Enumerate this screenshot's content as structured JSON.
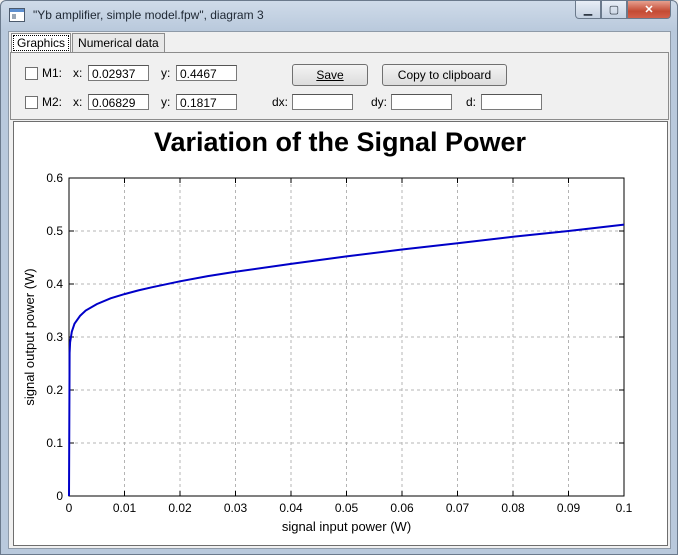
{
  "window": {
    "title": "\"Yb amplifier, simple model.fpw\", diagram 3",
    "minimize_glyph": "▁",
    "maximize_glyph": "▢",
    "close_glyph": "✕"
  },
  "tabs": [
    {
      "label": "Graphics",
      "active": true
    },
    {
      "label": "Numerical data",
      "active": false
    }
  ],
  "markers": {
    "m1": {
      "label": "M1:",
      "x_label": "x:",
      "x": "0.02937",
      "y_label": "y:",
      "y": "0.4467",
      "checked": false
    },
    "m2": {
      "label": "M2:",
      "x_label": "x:",
      "x": "0.06829",
      "y_label": "y:",
      "y": "0.1817",
      "checked": false
    },
    "dx_label": "dx:",
    "dx": "",
    "dy_label": "dy:",
    "dy": "",
    "d_label": "d:",
    "d": ""
  },
  "buttons": {
    "save": "Save",
    "copy": "Copy to clipboard"
  },
  "chart_data": {
    "type": "line",
    "title": "Variation of the Signal Power",
    "xlabel": "signal input power (W)",
    "ylabel": "signal output power (W)",
    "xlim": [
      0,
      0.1
    ],
    "ylim": [
      0,
      0.6
    ],
    "x_ticks": [
      "0",
      "0.01",
      "0.02",
      "0.03",
      "0.04",
      "0.05",
      "0.06",
      "0.07",
      "0.08",
      "0.09",
      "0.1"
    ],
    "y_ticks": [
      "0",
      "0.1",
      "0.2",
      "0.3",
      "0.4",
      "0.5",
      "0.6"
    ],
    "grid": true,
    "line_color": "#0000c8",
    "series": [
      {
        "x": [
          0,
          0.0001,
          0.0002,
          0.0005,
          0.001,
          0.002,
          0.003,
          0.005,
          0.0075,
          0.01,
          0.0125,
          0.015,
          0.02,
          0.025,
          0.03,
          0.04,
          0.05,
          0.06,
          0.07,
          0.08,
          0.09,
          0.1
        ],
        "values": [
          0,
          0.27,
          0.29,
          0.31,
          0.325,
          0.34,
          0.35,
          0.362,
          0.373,
          0.381,
          0.388,
          0.394,
          0.405,
          0.415,
          0.423,
          0.438,
          0.452,
          0.465,
          0.477,
          0.489,
          0.5,
          0.512
        ]
      }
    ]
  }
}
